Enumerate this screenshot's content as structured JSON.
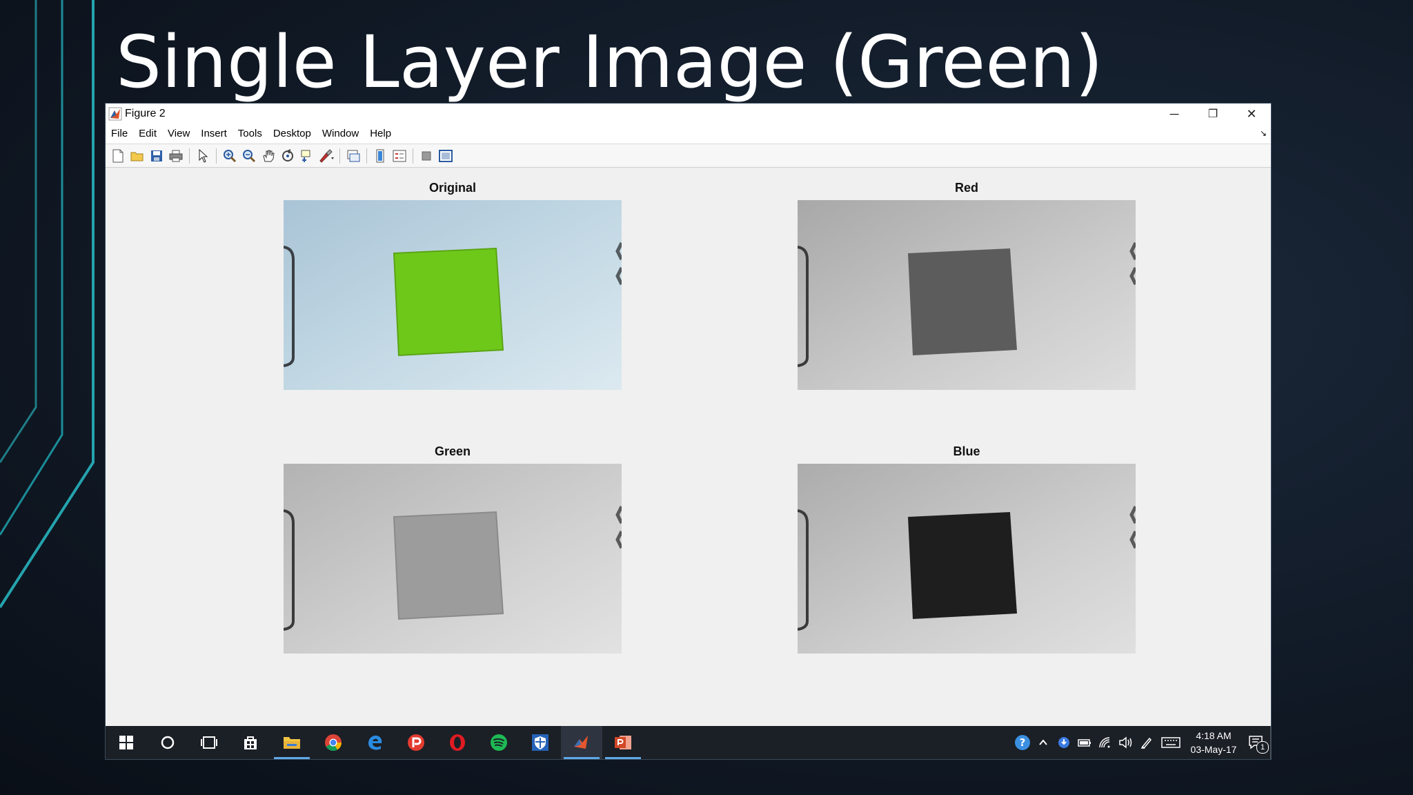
{
  "slide": {
    "title": "Single Layer Image (Green)"
  },
  "window": {
    "title": "Figure 2",
    "controls": {
      "minimize": "─",
      "restore": "❐",
      "close": "✕"
    }
  },
  "menu": {
    "items": [
      "File",
      "Edit",
      "View",
      "Insert",
      "Tools",
      "Desktop",
      "Window",
      "Help"
    ],
    "arrow": "↘"
  },
  "toolbar": {
    "buttons": [
      "new-figure",
      "open-file",
      "save",
      "print",
      "edit-plot",
      "zoom-in",
      "zoom-out",
      "pan",
      "rotate-3d",
      "data-cursor",
      "brush",
      "link-plot",
      "insert-colorbar",
      "insert-legend",
      "hide-plot-tools",
      "show-plot-tools"
    ]
  },
  "figure": {
    "subplots": [
      {
        "title": "Original",
        "variant": "original"
      },
      {
        "title": "Red",
        "variant": "red"
      },
      {
        "title": "Green",
        "variant": "green"
      },
      {
        "title": "Blue",
        "variant": "blue"
      }
    ]
  },
  "taskbar": {
    "apps": [
      "start",
      "cortana",
      "task-view",
      "store",
      "file-explorer",
      "chrome",
      "edge",
      "pocketcasts",
      "opera",
      "spotify",
      "defender",
      "matlab",
      "powerpoint"
    ],
    "time": "4:18 AM",
    "date": "03-May-17",
    "notification_count": "1"
  }
}
